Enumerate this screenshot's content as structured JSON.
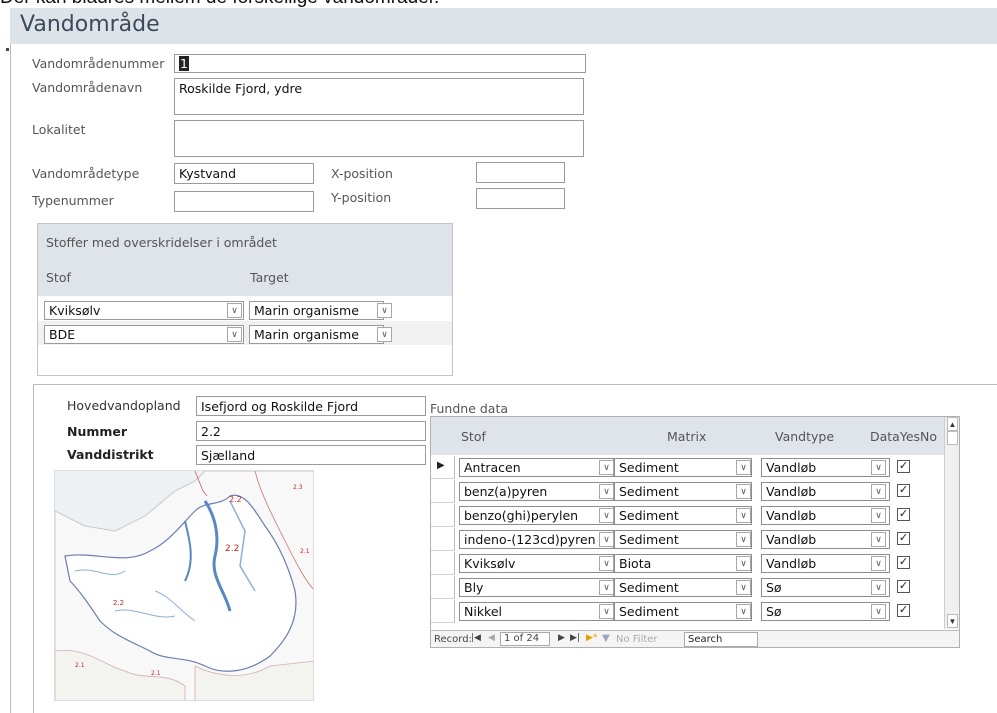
{
  "intro_text": "Der kan bladres mellem de forskellige vandområder.",
  "form": {
    "title": "Vandområde",
    "fields": {
      "nummer": {
        "label": "Vandområdenummer",
        "value": "1"
      },
      "navn": {
        "label": "Vandområdenavn",
        "value": "Roskilde Fjord, ydre"
      },
      "lokalitet": {
        "label": "Lokalitet",
        "value": ""
      },
      "type": {
        "label": "Vandområdetype",
        "value": "Kystvand"
      },
      "typenummer": {
        "label": "Typenummer",
        "value": ""
      },
      "xpos": {
        "label": "X-position",
        "value": ""
      },
      "ypos": {
        "label": "Y-position",
        "value": ""
      }
    }
  },
  "overskridelser": {
    "title": "Stoffer med overskridelser i området",
    "col_stof": "Stof",
    "col_target": "Target",
    "rows": [
      {
        "stof": "Kviksølv",
        "target": "Marin organisme"
      },
      {
        "stof": "BDE",
        "target": "Marin organisme"
      }
    ]
  },
  "opland": {
    "hovedvandopland_label": "Hovedvandopland",
    "hovedvandopland_value": "Isefjord og Roskilde Fjord",
    "nummer_label": "Nummer",
    "nummer_value": "2.2",
    "vanddistrikt_label": "Vanddistrikt",
    "vanddistrikt_value": "Sjælland"
  },
  "map": {
    "labels": [
      "2.2",
      "2.3",
      "2.2",
      "2.1",
      "2.2",
      "2.1",
      "2.1"
    ]
  },
  "fundne": {
    "title": "Fundne data",
    "headers": {
      "stof": "Stof",
      "matrix": "Matrix",
      "vandtype": "Vandtype",
      "datayesno": "DataYesNo"
    },
    "rows": [
      {
        "stof": "Antracen",
        "matrix": "Sediment",
        "vandtype": "Vandløb",
        "checked": true
      },
      {
        "stof": "benz(a)pyren",
        "matrix": "Sediment",
        "vandtype": "Vandløb",
        "checked": true
      },
      {
        "stof": "benzo(ghi)perylen",
        "matrix": "Sediment",
        "vandtype": "Vandløb",
        "checked": true
      },
      {
        "stof": "indeno-(123cd)pyren",
        "matrix": "Sediment",
        "vandtype": "Vandløb",
        "checked": true
      },
      {
        "stof": "Kviksølv",
        "matrix": "Biota",
        "vandtype": "Vandløb",
        "checked": true
      },
      {
        "stof": "Bly",
        "matrix": "Sediment",
        "vandtype": "Sø",
        "checked": true
      },
      {
        "stof": "Nikkel",
        "matrix": "Sediment",
        "vandtype": "Sø",
        "checked": true
      }
    ],
    "nav": {
      "record_label": "Record:",
      "position": "1 of 24",
      "filter": "No Filter",
      "search": "Search"
    }
  },
  "colors": {
    "header_bg": "#dee3ea",
    "check": "#222222"
  }
}
